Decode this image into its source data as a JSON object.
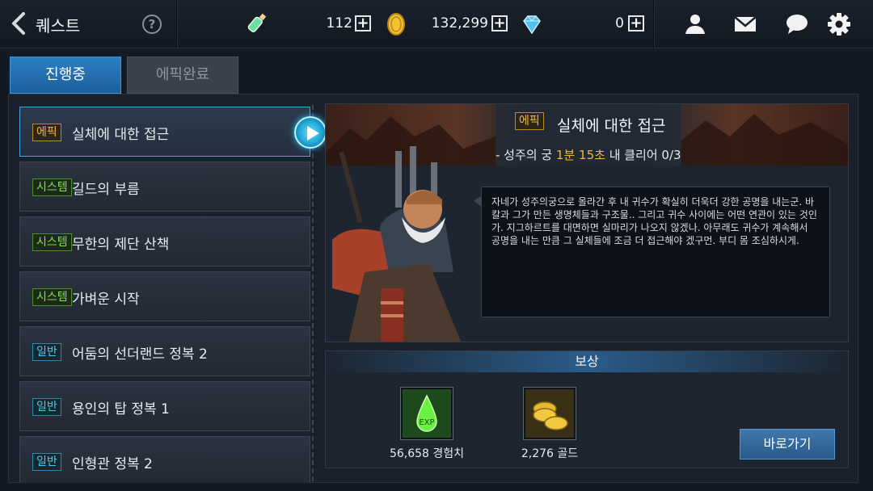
{
  "header": {
    "title": "퀘스트",
    "help_label": "?",
    "currencies": [
      {
        "name": "stamina-potion",
        "value": "112",
        "plus": "+"
      },
      {
        "name": "gold",
        "value": "132,299",
        "plus": "+"
      },
      {
        "name": "gem",
        "value": "0",
        "plus": "+"
      }
    ],
    "icons": [
      "friends-icon",
      "mail-icon",
      "chat-icon",
      "settings-icon"
    ]
  },
  "tabs": [
    {
      "label": "진행중",
      "active": true
    },
    {
      "label": "에픽완료",
      "active": false
    }
  ],
  "quests": [
    {
      "badge": "에픽",
      "type": "epic",
      "name": "실체에 대한 접근",
      "selected": true
    },
    {
      "badge": "시스템",
      "type": "system",
      "name": "길드의 부름"
    },
    {
      "badge": "시스템",
      "type": "system",
      "name": "무한의 제단 산책"
    },
    {
      "badge": "시스템",
      "type": "system",
      "name": "가벼운 시작"
    },
    {
      "badge": "일반",
      "type": "normal",
      "name": "어둠의 선더랜드 정복 2"
    },
    {
      "badge": "일반",
      "type": "normal",
      "name": "용인의 탑 정복 1"
    },
    {
      "badge": "일반",
      "type": "normal",
      "name": "인형관 정복 2"
    }
  ],
  "detail": {
    "badge": "에픽",
    "title": "실체에 대한 접근",
    "sub_prefix": "- 성주의 궁 ",
    "sub_time": "1분 15초",
    "sub_suffix": " 내 클리어 0/3",
    "dialog": "자네가 성주의궁으로 올라간 후 내 귀수가 확실히 더욱더 강한 공명을 내는군. 바칼과 그가 만든 생명체들과 구조물.. 그리고 귀수 사이에는 어떤 연관이 있는 것인가. 지그하르트를 대면하면 실마리가 나오지 않겠나. 아무래도 귀수가 계속해서 공명을 내는 만큼 그 실체들에 조금 더 접근해야 겠구먼. 부디 몸 조심하시게."
  },
  "reward": {
    "header": "보상",
    "items": [
      {
        "icon": "exp-potion-icon",
        "label": "56,658 경험치"
      },
      {
        "icon": "gold-coins-icon",
        "label": "2,276 골드"
      }
    ],
    "go_button": "바로가기"
  },
  "colors": {
    "accent_blue": "#2c7fc4",
    "epic": "#f0b640",
    "system": "#7ee04a",
    "normal": "#4fc8e8"
  }
}
